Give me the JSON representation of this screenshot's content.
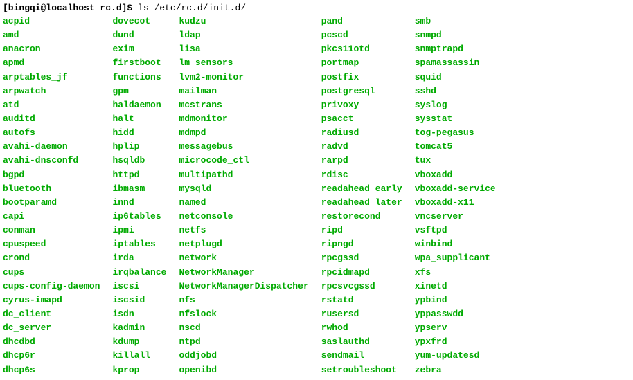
{
  "prompt": {
    "user_host": "[bingqi@localhost rc.d]$",
    "command": "ls /etc/rc.d/init.d/"
  },
  "columns": [
    [
      "acpid",
      "amd",
      "anacron",
      "apmd",
      "arptables_jf",
      "arpwatch",
      "atd",
      "auditd",
      "autofs",
      "avahi-daemon",
      "avahi-dnsconfd",
      "bgpd",
      "bluetooth",
      "bootparamd",
      "capi",
      "conman",
      "cpuspeed",
      "crond",
      "cups",
      "cups-config-daemon",
      "cyrus-imapd",
      "dc_client",
      "dc_server",
      "dhcdbd",
      "dhcp6r",
      "dhcp6s"
    ],
    [
      "dovecot",
      "dund",
      "exim",
      "firstboot",
      "functions",
      "gpm",
      "haldaemon",
      "halt",
      "hidd",
      "hplip",
      "hsqldb",
      "httpd",
      "ibmasm",
      "innd",
      "ip6tables",
      "ipmi",
      "iptables",
      "irda",
      "irqbalance",
      "iscsi",
      "iscsid",
      "isdn",
      "kadmin",
      "kdump",
      "killall",
      "kprop"
    ],
    [
      "kudzu",
      "ldap",
      "lisa",
      "lm_sensors",
      "lvm2-monitor",
      "mailman",
      "mcstrans",
      "mdmonitor",
      "mdmpd",
      "messagebus",
      "microcode_ctl",
      "multipathd",
      "mysqld",
      "named",
      "netconsole",
      "netfs",
      "netplugd",
      "network",
      "NetworkManager",
      "NetworkManagerDispatcher",
      "nfs",
      "nfslock",
      "nscd",
      "ntpd",
      "oddjobd",
      "openibd"
    ],
    [
      "pand",
      "pcscd",
      "pkcs11otd",
      "portmap",
      "postfix",
      "postgresql",
      "privoxy",
      "psacct",
      "radiusd",
      "radvd",
      "rarpd",
      "rdisc",
      "readahead_early",
      "readahead_later",
      "restorecond",
      "ripd",
      "ripngd",
      "rpcgssd",
      "rpcidmapd",
      "rpcsvcgssd",
      "rstatd",
      "rusersd",
      "rwhod",
      "saslauthd",
      "sendmail",
      "setroubleshoot"
    ],
    [
      "smb",
      "snmpd",
      "snmptrapd",
      "spamassassin",
      "squid",
      "sshd",
      "syslog",
      "sysstat",
      "tog-pegasus",
      "tomcat5",
      "tux",
      "vboxadd",
      "vboxadd-service",
      "vboxadd-x11",
      "vncserver",
      "vsftpd",
      "winbind",
      "wpa_supplicant",
      "xfs",
      "xinetd",
      "ypbind",
      "yppasswdd",
      "ypserv",
      "ypxfrd",
      "yum-updatesd",
      "zebra"
    ]
  ]
}
